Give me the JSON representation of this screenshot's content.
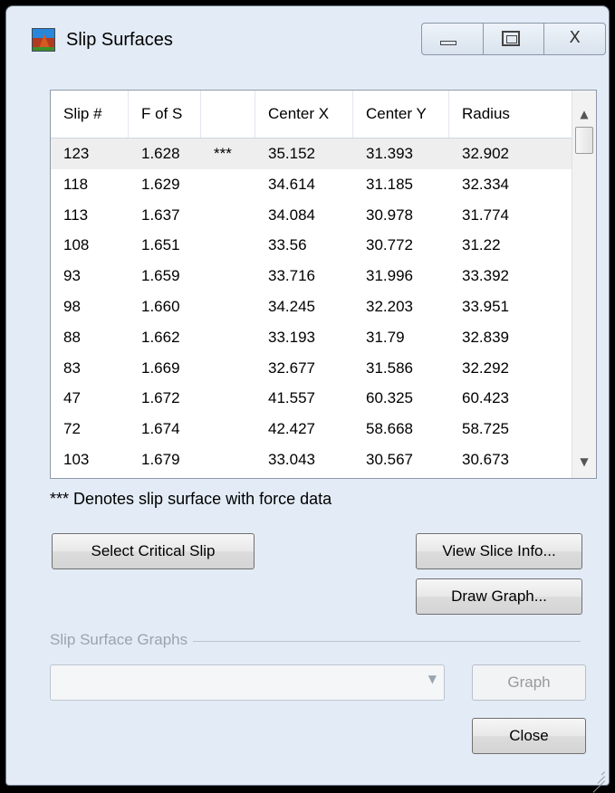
{
  "window": {
    "title": "Slip Surfaces",
    "icon": "app-logo-icon",
    "caption_buttons": [
      "minimize-icon",
      "maximize-icon",
      "close-icon"
    ],
    "close_glyph": "X"
  },
  "table": {
    "columns": [
      "Slip #",
      "F of S",
      "",
      "Center X",
      "Center Y",
      "Radius"
    ],
    "rows": [
      {
        "slip": "123",
        "fos": "1.628",
        "flag": "***",
        "cx": "35.152",
        "cy": "31.393",
        "r": "32.902"
      },
      {
        "slip": "118",
        "fos": "1.629",
        "flag": "",
        "cx": "34.614",
        "cy": "31.185",
        "r": "32.334"
      },
      {
        "slip": "113",
        "fos": "1.637",
        "flag": "",
        "cx": "34.084",
        "cy": "30.978",
        "r": "31.774"
      },
      {
        "slip": "108",
        "fos": "1.651",
        "flag": "",
        "cx": "33.56",
        "cy": "30.772",
        "r": "31.22"
      },
      {
        "slip": "93",
        "fos": "1.659",
        "flag": "",
        "cx": "33.716",
        "cy": "31.996",
        "r": "33.392"
      },
      {
        "slip": "98",
        "fos": "1.660",
        "flag": "",
        "cx": "34.245",
        "cy": "32.203",
        "r": "33.951"
      },
      {
        "slip": "88",
        "fos": "1.662",
        "flag": "",
        "cx": "33.193",
        "cy": "31.79",
        "r": "32.839"
      },
      {
        "slip": "83",
        "fos": "1.669",
        "flag": "",
        "cx": "32.677",
        "cy": "31.586",
        "r": "32.292"
      },
      {
        "slip": "47",
        "fos": "1.672",
        "flag": "",
        "cx": "41.557",
        "cy": "60.325",
        "r": "60.423"
      },
      {
        "slip": "72",
        "fos": "1.674",
        "flag": "",
        "cx": "42.427",
        "cy": "58.668",
        "r": "58.725"
      },
      {
        "slip": "103",
        "fos": "1.679",
        "flag": "",
        "cx": "33.043",
        "cy": "30.567",
        "r": "30.673"
      }
    ],
    "selected_row": 0,
    "scroll_up_glyph": "▲",
    "scroll_down_glyph": "▼"
  },
  "note": "*** Denotes slip surface with force data",
  "buttons": {
    "select_critical": "Select Critical Slip",
    "view_slice_info": "View Slice Info...",
    "draw_graph": "Draw Graph...",
    "graph": "Graph",
    "close": "Close"
  },
  "graphs_group": {
    "label": "Slip Surface Graphs",
    "combo_value": "",
    "combo_arrow": "▼"
  }
}
